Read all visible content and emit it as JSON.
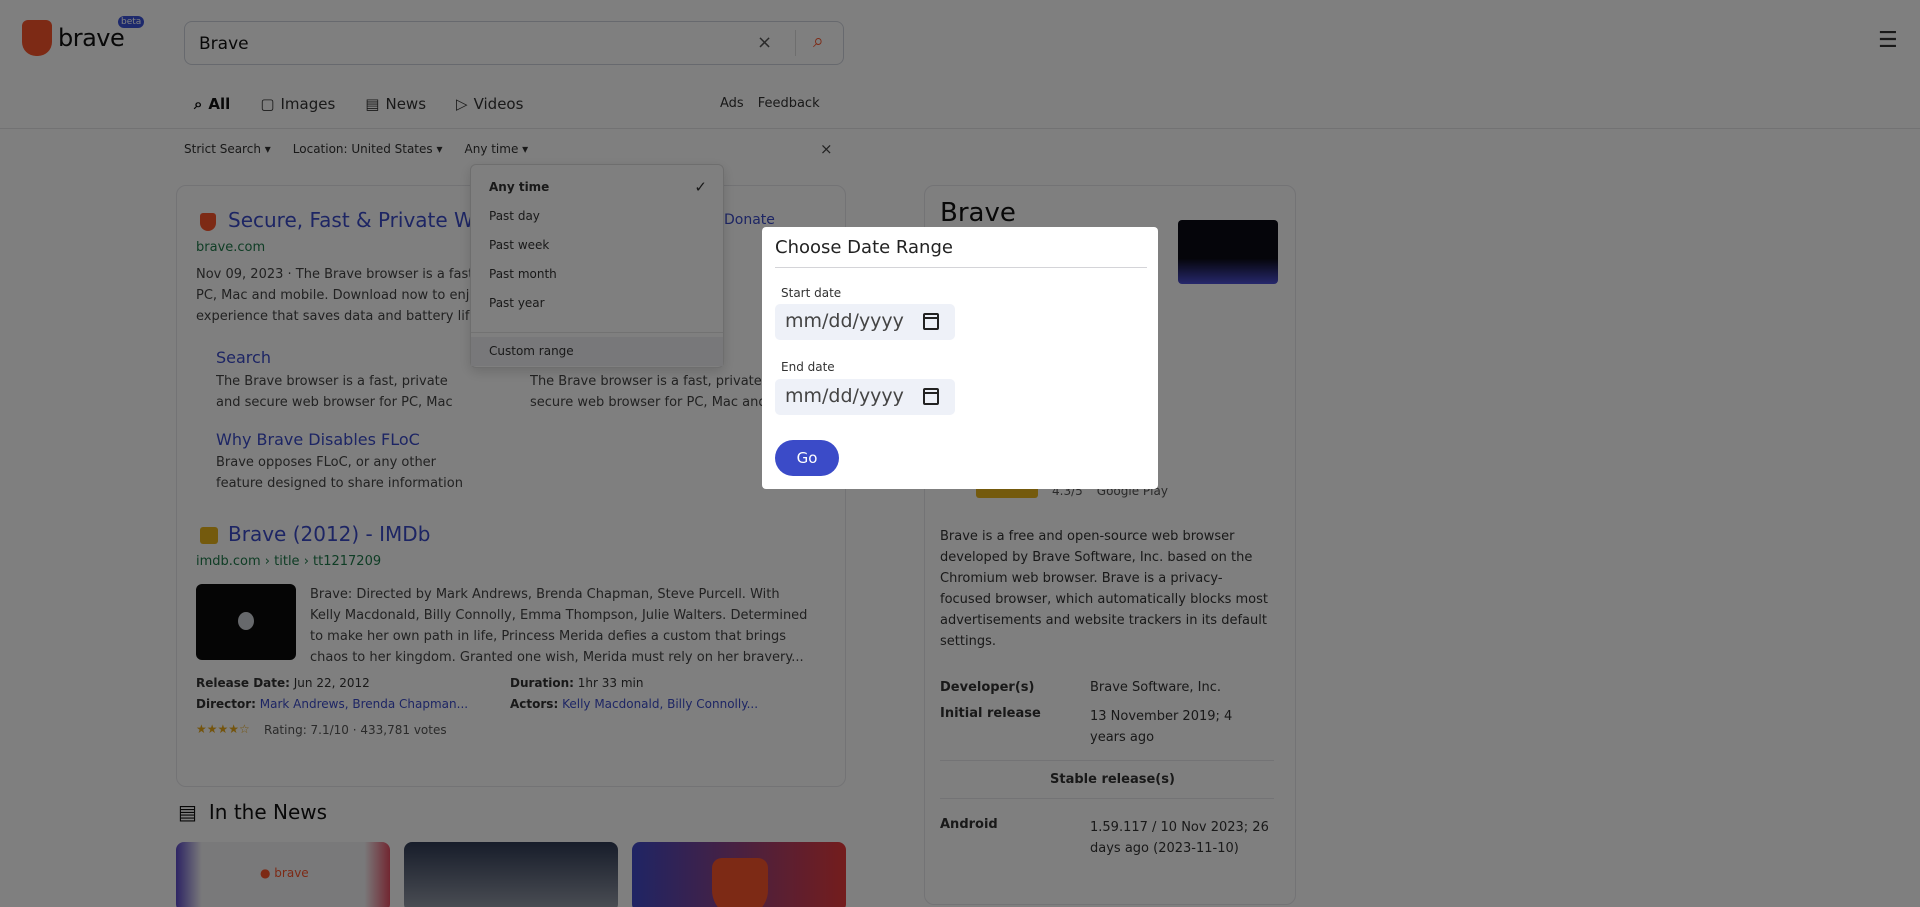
{
  "header": {
    "logo_text": "brave",
    "logo_beta": "beta",
    "search_value": "Brave"
  },
  "tabs": [
    {
      "label": "All"
    },
    {
      "label": "Images"
    },
    {
      "label": "News"
    },
    {
      "label": "Videos"
    }
  ],
  "tab_links": {
    "settings": "Ads",
    "feedback": "Feedback"
  },
  "filters": {
    "safe_search": "Strict Search ▾",
    "location": "Location: United States ▾",
    "date": "Any time ▾"
  },
  "date_menu": {
    "options": [
      "Any time",
      "Past day",
      "Past week",
      "Past month",
      "Past year"
    ],
    "custom": "Custom range"
  },
  "result1": {
    "title": "Secure, Fast & Private Web Browser",
    "host": "brave.com",
    "more": "Donate",
    "snippet": "Nov 09, 2023 · The Brave browser is a fast, private and secure web browser for PC, Mac and mobile. Download now to enjoy a faster ad-free browsing experience that saves data and battery life by blocking tracking software.",
    "sitelink1_title": "Search",
    "sitelink1_text": "The Brave browser is a fast, private and secure web browser for PC, Mac and mobile.",
    "sitelink2_title": "Why Brave Disables FLoC",
    "sitelink2_text": "Brave opposes FLoC, or any other feature designed to share information about your browsing",
    "sitelink3_text": "The Brave browser is a fast, private and secure web browser for PC, Mac and mobile."
  },
  "result2": {
    "title": "Brave (2012) - IMDb",
    "host": "imdb.com › title › tt1217209",
    "snippet": "Brave: Directed by Mark Andrews, Brenda Chapman, Steve Purcell. With Kelly Macdonald, Billy Connolly, Emma Thompson, Julie Walters. Determined to make her own path in life, Princess Merida defies a custom that brings chaos to her kingdom. Granted one wish, Merida must rely on her bravery...",
    "release_label": "Release Date:",
    "release_value": "Jun 22, 2012",
    "duration_label": "Duration:",
    "duration_value": "1hr 33 min",
    "director_label": "Director:",
    "director_value": "Mark Andrews, Brenda Chapman...",
    "actors_label": "Actors:",
    "actors_value": "Kelly Macdonald, Billy Connolly...",
    "stars": "★★★★☆",
    "rating_text": "Rating: 7.1/10 · 433,781 votes"
  },
  "news": {
    "heading": "In the News"
  },
  "infobox": {
    "title": "Brave",
    "rating_text": "4.3/5",
    "rating_source": "Google Play",
    "description": "Brave is a free and open-source web browser developed by Brave Software, Inc. based on the Chromium web browser. Brave is a privacy-focused browser, which automatically blocks most advertisements and website trackers in its default settings.",
    "developer_key": "Developer(s)",
    "developer_value": "Brave Software, Inc.",
    "release_key": "Initial release",
    "release_value": "13 November 2019; 4 years ago",
    "stable_heading": "Stable release(s)",
    "android_key": "Android",
    "android_value": "1.59.117 / 10 Nov 2023; 26 days ago (2023-11-10)"
  },
  "modal": {
    "title": "Choose Date Range",
    "start_label": "Start date",
    "start_value": "mm/dd/yyyy",
    "end_label": "End date",
    "end_value": "mm/dd/yyyy",
    "go_label": "Go"
  }
}
